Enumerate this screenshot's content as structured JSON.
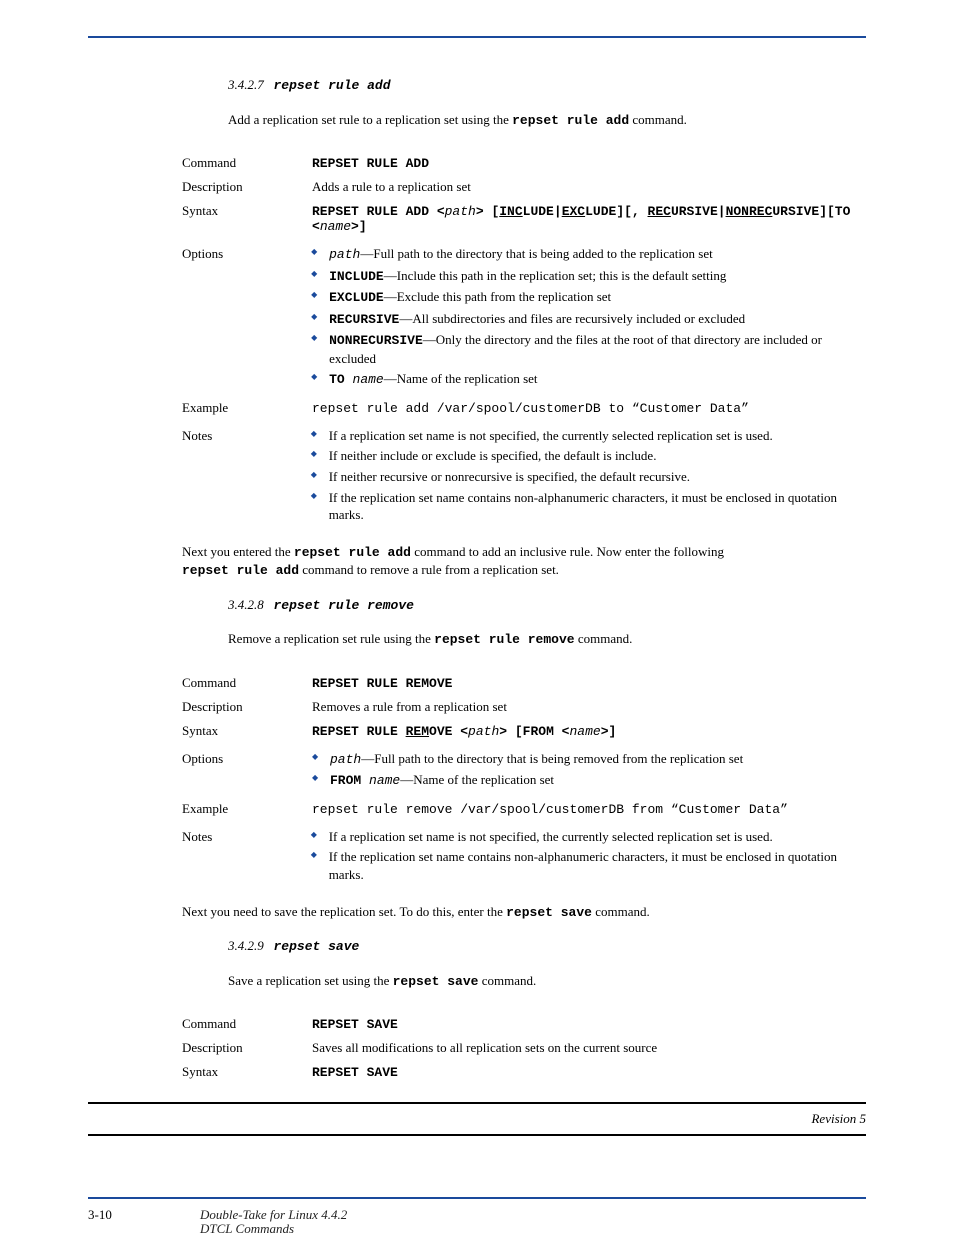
{
  "page_number": "3-10",
  "footer_product": "Double-Take for Linux 4.4.2",
  "footer_section": "DTCL Commands",
  "sec_add": {
    "cmd_title": "repset rule add",
    "intro": "Add a replication set rule to a replication set using the ",
    "intro_cmd": "repset rule add",
    "intro_tail": " command.",
    "label_command": "Command",
    "command_name": "REPSET RULE ADD",
    "label_desc": "Description",
    "description": "Adds a rule to a replication set",
    "label_syntax": "Syntax",
    "syntax_pre": "REPSET RULE ADD <",
    "syntax_path": "path",
    "syntax_mid1": "> [",
    "syntax_inc": "INC",
    "syntax_lude": "LUDE",
    "syntax_pipe": "|",
    "syntax_exc": "EXC",
    "syntax_mid2": "][, ",
    "syntax_rec": "REC",
    "syntax_ursive": "URSIVE",
    "syntax_nonrec": "NONREC",
    "syntax_mid3": "][TO",
    "syntax_line2_open": "<",
    "syntax_name": "name",
    "syntax_line2_close": ">]",
    "label_options": "Options",
    "opt_path": "—Full path to the directory that is being added to the replication set",
    "opt_path_key": "path",
    "opt_include_key": "INCLUDE",
    "opt_include": "—Include this path in the replication set; this is the default setting",
    "opt_exclude_key": "EXCLUDE",
    "opt_exclude": "—Exclude this path from the replication set",
    "opt_recursive_key": "RECURSIVE",
    "opt_recursive": "—All subdirectories and files are recursively included or excluded",
    "opt_nonrecursive_key": "NONRECURSIVE",
    "opt_nonrecursive": "—Only the directory and the files at the root of that directory are included or excluded",
    "opt_to_key": "TO ",
    "opt_to_name": "name",
    "opt_to": "—Name of the replication set",
    "label_example": "Example",
    "example": "repset rule add /var/spool/customerDB to “Customer Data”",
    "label_notes": "Notes",
    "note1": "If a replication set name is not specified, the currently selected replication set is used.",
    "note2": "If neither include or exclude is specified, the default is include.",
    "note3": "If neither recursive or nonrecursive is specified, the default recursive.",
    "note4": "If the replication set name contains non-alphanumeric characters, it must be enclosed in quotation marks.",
    "end1": "Next you entered the ",
    "end1_cmd": "repset rule add",
    "end1_tail": " command to add an inclusive rule. Now enter the following",
    "end2": " command to remove a rule from a replication set."
  },
  "sec_remove": {
    "cmd_title": "repset rule remove",
    "intro": "Remove a replication set rule using the ",
    "intro_cmd": "repset rule remove",
    "intro_tail": " command.",
    "label_command": "Command",
    "command_name": "REPSET RULE REMOVE",
    "label_desc": "Description",
    "description": "Removes a rule from a replication set",
    "label_syntax": "Syntax",
    "syntax_pre": "REPSET RULE ",
    "syntax_rem": "REM",
    "syntax_ove": "OVE <",
    "syntax_path": "path",
    "syntax_mid": "> [FROM <",
    "syntax_name": "name",
    "syntax_close": ">]",
    "label_options": "Options",
    "opt_path_key": "path",
    "opt_path": "—Full path to the directory that is being removed from the replication set",
    "opt_from_key": "FROM ",
    "opt_from_name": "name",
    "opt_from": "—Name of the replication set",
    "label_example": "Example",
    "example": "repset rule remove /var/spool/customerDB from “Customer Data”",
    "label_notes": "Notes",
    "note1": "If a replication set name is not specified, the currently selected replication set is used.",
    "note2": "If the replication set name contains non-alphanumeric characters, it must be enclosed in quotation marks.",
    "end1": "Next you need to save the replication set. To do this, enter the ",
    "end1_cmd": "repset save",
    "end1_tail": " command."
  },
  "sec_save": {
    "cmd_title": "repset save",
    "intro": "Save a replication set using the ",
    "intro_cmd": "repset save",
    "intro_tail": " command.",
    "label_command": "Command",
    "command_name": "REPSET SAVE",
    "label_desc": "Description",
    "description": "Saves all modifications to all replication sets on the current source",
    "label_syntax": "Syntax",
    "syntax": "REPSET SAVE"
  }
}
